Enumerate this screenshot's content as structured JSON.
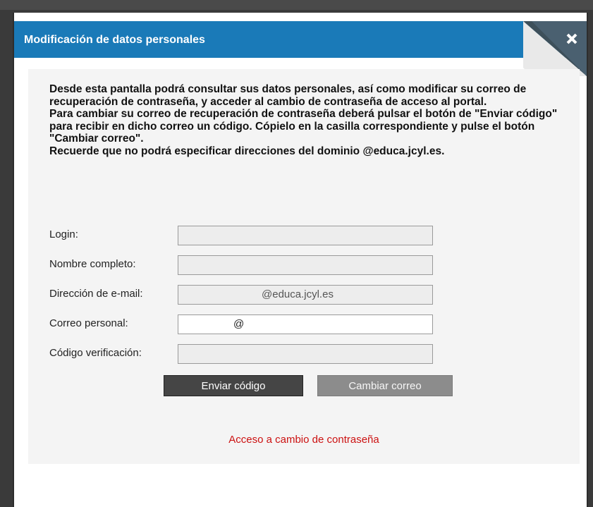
{
  "dialog": {
    "title": "Modificación de datos personales",
    "close_icon": "close-x-icon",
    "colors": {
      "titlebar": "#1a7ab8",
      "link": "#cc1111",
      "primary_button": "#454545",
      "secondary_button": "#8c8c8c"
    }
  },
  "intro": {
    "p1": "Desde esta pantalla podrá consultar sus datos personales, así como modificar su correo de recuperación de contraseña, y acceder al cambio de contraseña de acceso al portal.",
    "p2": "Para cambiar su correo de recuperación de contraseña deberá pulsar el botón de \"Enviar código\" para recibir en dicho correo un código. Cópielo en la casilla correspondiente y pulse el botón \"Cambiar correo\".",
    "p3": "Recuerde que no podrá especificar direcciones del dominio @educa.jcyl.es."
  },
  "form": {
    "login_label": "Login:",
    "login_value": "",
    "fullname_label": "Nombre completo:",
    "fullname_value": "",
    "email_label": "Dirección de e-mail:",
    "email_suffix": "@educa.jcyl.es",
    "personal_label": "Correo personal:",
    "personal_at": "@",
    "code_label": "Código verificación:",
    "code_value": ""
  },
  "buttons": {
    "send_code": "Enviar código",
    "change_email": "Cambiar correo"
  },
  "link": {
    "password_change": "Acceso a cambio de contraseña"
  }
}
